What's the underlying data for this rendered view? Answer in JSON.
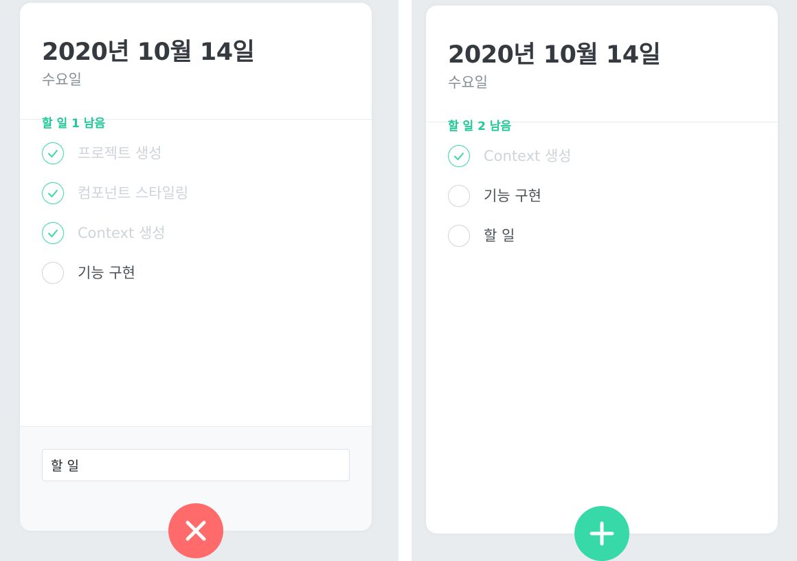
{
  "left": {
    "header": {
      "date": "2020년 10월 14일",
      "day": "수요일",
      "tasks_left": "할 일 1 남음"
    },
    "items": [
      {
        "text": "프로젝트 생성",
        "done": true
      },
      {
        "text": "컴포넌트 스타일링",
        "done": true
      },
      {
        "text": "Context 생성",
        "done": true
      },
      {
        "text": "기능 구현",
        "done": false
      }
    ],
    "input_value": "할 일",
    "fab_icon": "close-icon",
    "fab_color": "#ff6b6b"
  },
  "right": {
    "header": {
      "date": "2020년 10월 14일",
      "day": "수요일",
      "tasks_left": "할 일 2 남음"
    },
    "items": [
      {
        "text": "Context 생성",
        "done": true
      },
      {
        "text": "기능 구현",
        "done": false
      },
      {
        "text": "할 일",
        "done": false
      }
    ],
    "fab_icon": "plus-icon",
    "fab_color": "#38d9a9"
  },
  "colors": {
    "accent": "#20c997",
    "check_border": "#38d9a9",
    "done_text": "#ced4da",
    "text": "#495057",
    "background": "#e9ecef"
  }
}
